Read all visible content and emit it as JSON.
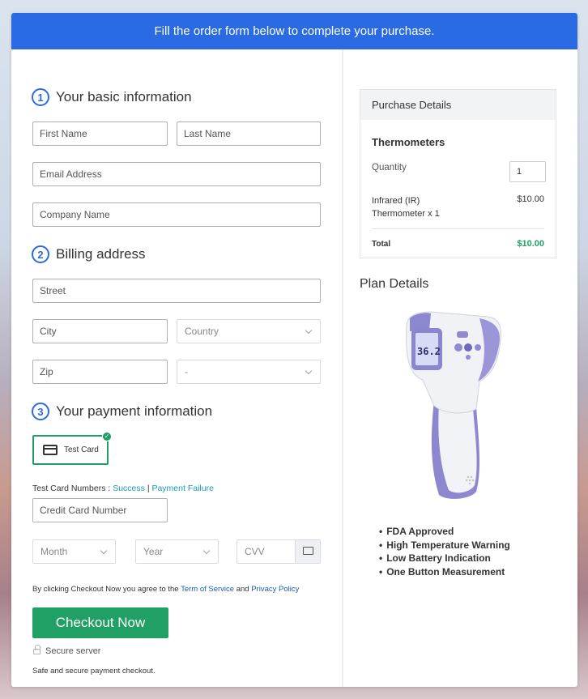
{
  "banner": "Fill the order form below to complete your purchase.",
  "section1": {
    "number": "1",
    "title": "Your basic information"
  },
  "section2": {
    "number": "2",
    "title": "Billing address"
  },
  "section3": {
    "number": "3",
    "title": "Your payment information"
  },
  "basic": {
    "first_name": "First Name",
    "last_name": "Last Name",
    "email": "Email Address",
    "company": "Company Name"
  },
  "billing": {
    "street": "Street",
    "city": "City",
    "country": "Country",
    "zip": "Zip",
    "state": "-"
  },
  "payment": {
    "test_card_label": "Test Card",
    "test_numbers_label": "Test Card Numbers :",
    "success_link": "Success",
    "separator": "|",
    "failure_link": "Payment Failure",
    "card_number": "Credit Card Number",
    "month": "Month",
    "year": "Year",
    "cvv": "CVV"
  },
  "terms": {
    "prefix": "By clicking Checkout Now you agree to the",
    "tos": "Term of Service",
    "and": "and",
    "privacy": "Privacy Policy"
  },
  "checkout_button": "Checkout Now",
  "secure_server": "Secure server",
  "safe_text": "Safe and secure payment checkout.",
  "purchase": {
    "header": "Purchase Details",
    "product": "Thermometers",
    "quantity_label": "Quantity",
    "quantity_value": "1",
    "item_line1": "Infrared (IR)",
    "item_line2": "Thermometer x 1",
    "item_price": "$10.00",
    "total_label": "Total",
    "total_value": "$10.00"
  },
  "plan": {
    "title": "Plan Details",
    "features": [
      "FDA Approved",
      "High Temperature Warning",
      "Low Battery Indication",
      "One Button Measurement"
    ],
    "display_reading": "36.2"
  },
  "colors": {
    "banner": "#2a6be3",
    "accent_green": "#21a066",
    "link_teal": "#1c9aa8",
    "link_blue": "#1b5ea9"
  }
}
